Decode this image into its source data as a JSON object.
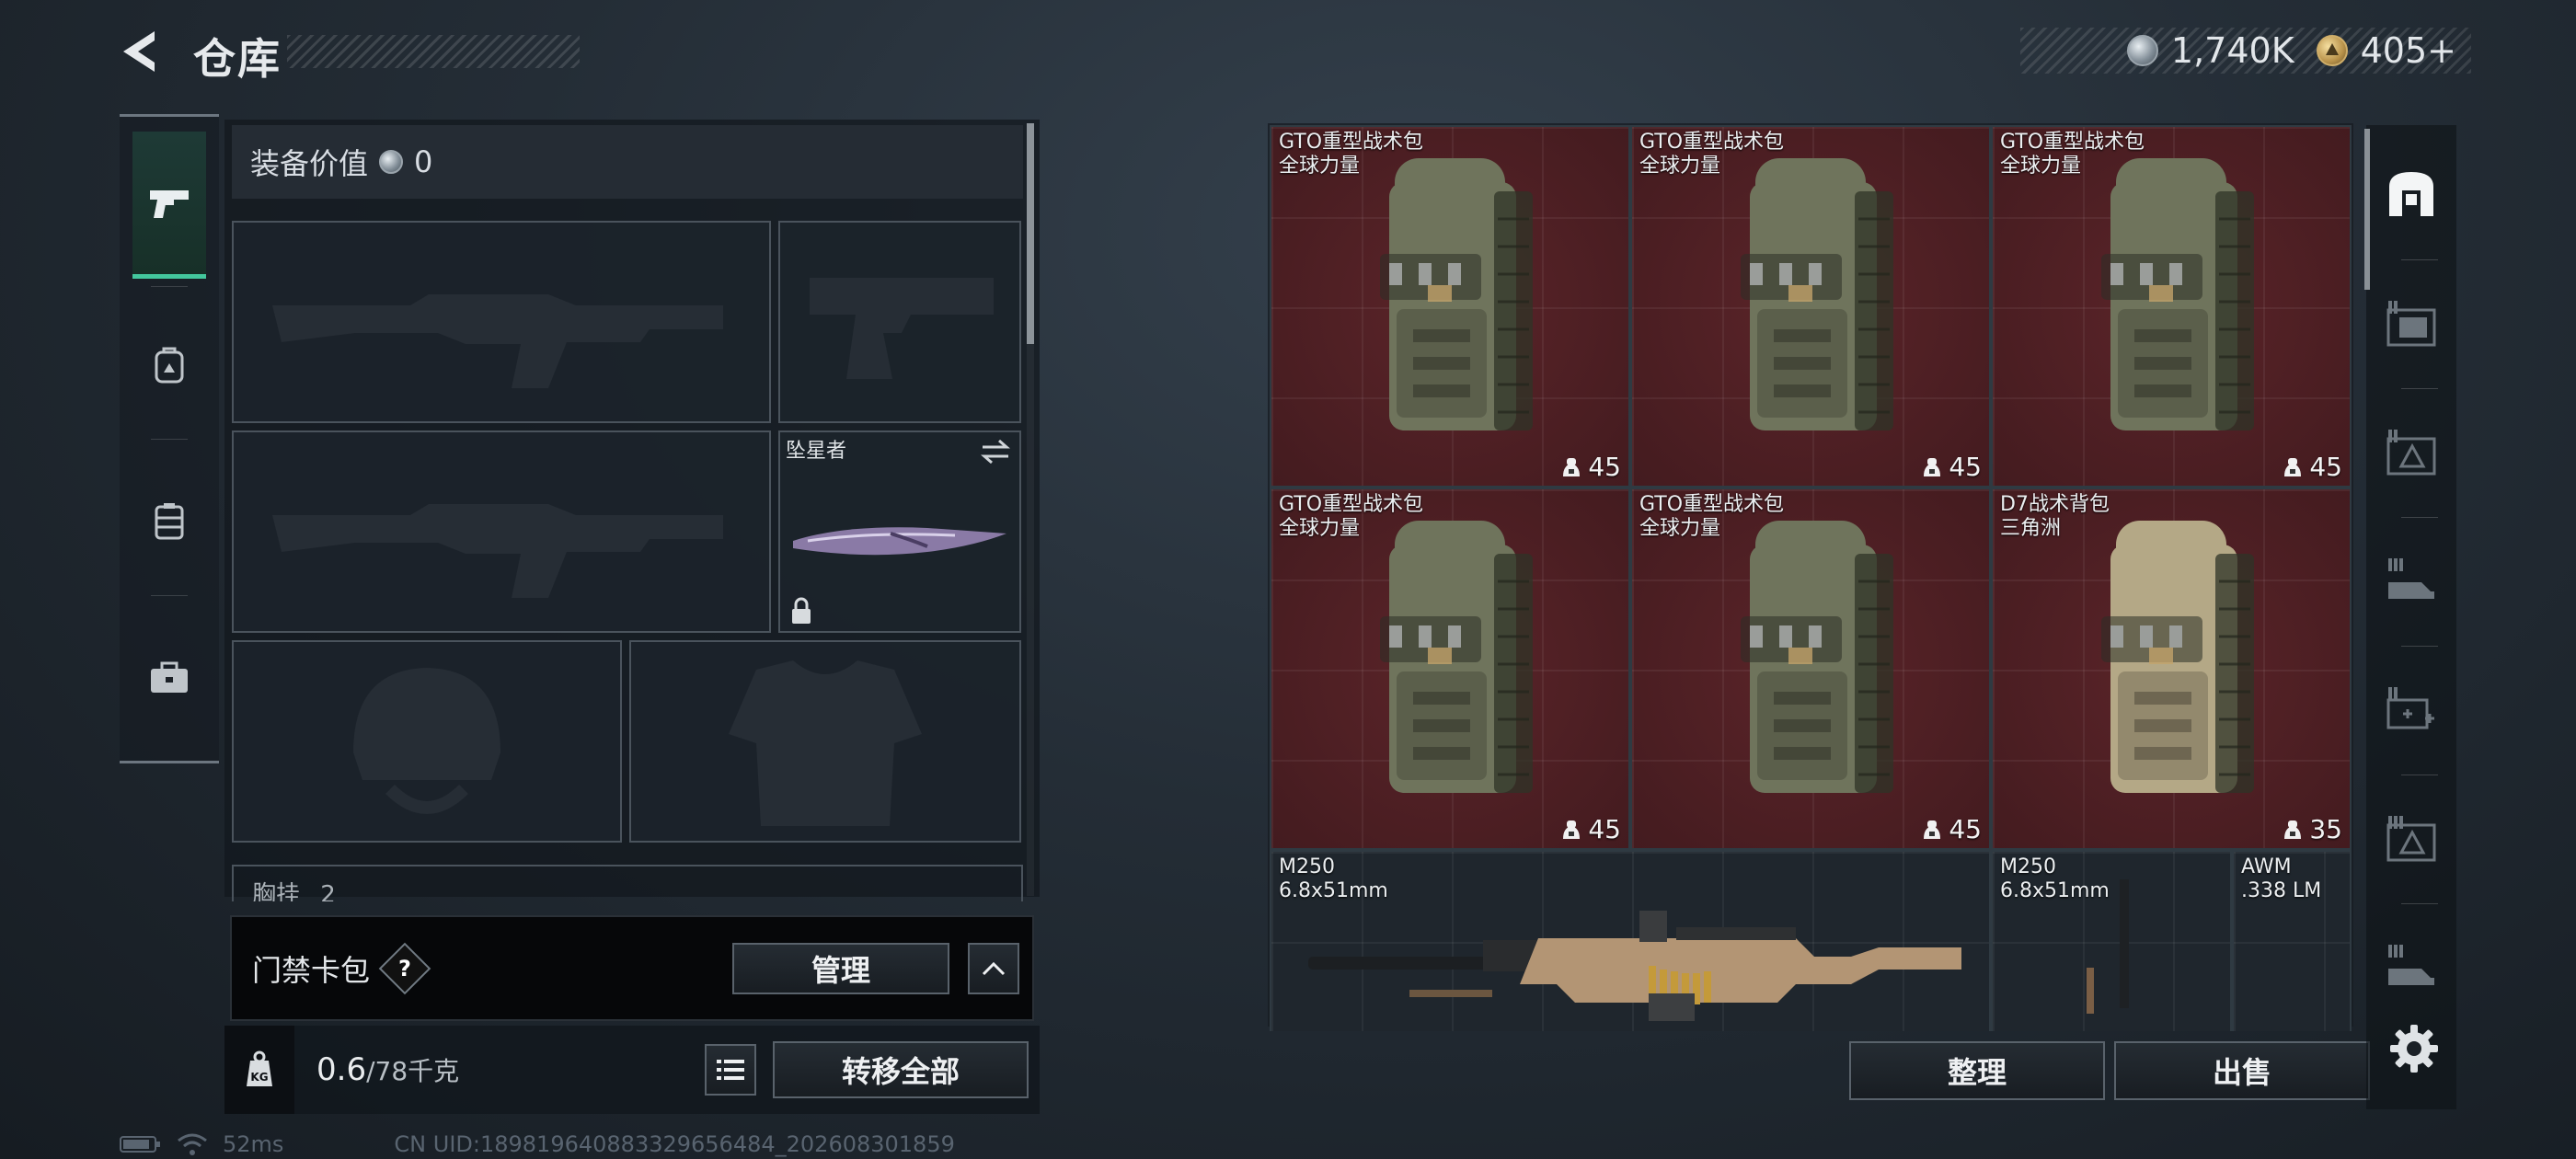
{
  "header": {
    "title": "仓库",
    "currencies": [
      {
        "icon": "silver-coin-icon",
        "value": "1,740K"
      },
      {
        "icon": "gold-triangle-coin-icon",
        "value": "405+"
      }
    ]
  },
  "left_tabs": [
    {
      "icon": "pistol-icon",
      "active": true
    },
    {
      "icon": "backpack-icon",
      "active": false
    },
    {
      "icon": "chest-rig-icon",
      "active": false
    },
    {
      "icon": "briefcase-icon",
      "active": false
    }
  ],
  "loadout": {
    "equip_value_label": "装备价值",
    "equip_value": "0",
    "melee_slot_label": "坠星者",
    "chest_label": "胸挂",
    "chest_count": "2"
  },
  "keycard": {
    "label": "门禁卡包",
    "help": "?",
    "manage_label": "管理"
  },
  "weight": {
    "kg_icon_label": "KG",
    "current": "0.6",
    "max": "/78千克",
    "transfer_all_label": "转移全部"
  },
  "status": {
    "ping": "52ms",
    "uid": "CN UID:18981964088332965​6484_202608301859"
  },
  "storage_items": [
    {
      "name": "GTO重型战术包",
      "sub": "全球力量",
      "capacity": "45"
    },
    {
      "name": "GTO重型战术包",
      "sub": "全球力量",
      "capacity": "45"
    },
    {
      "name": "GTO重型战术包",
      "sub": "全球力量",
      "capacity": "45"
    },
    {
      "name": "GTO重型战术包",
      "sub": "全球力量",
      "capacity": "45"
    },
    {
      "name": "GTO重型战术包",
      "sub": "全球力量",
      "capacity": "45"
    },
    {
      "name": "D7战术背包",
      "sub": "三角洲",
      "capacity": "35"
    }
  ],
  "weapon_items": [
    {
      "name": "M250",
      "sub": "6.8x51mm"
    },
    {
      "name": "M250",
      "sub": "6.8x51mm"
    },
    {
      "name": "AWM",
      "sub": ".338 LM"
    }
  ],
  "actions": {
    "organize_label": "整理",
    "sell_label": "出售"
  },
  "right_categories": [
    {
      "icon": "all-items-icon",
      "active": true
    },
    {
      "icon": "storage-1-icon"
    },
    {
      "icon": "storage-2-icon"
    },
    {
      "icon": "storage-3-icon"
    },
    {
      "icon": "storage-medical-icon"
    },
    {
      "icon": "storage-4-icon"
    },
    {
      "icon": "storage-5-icon"
    }
  ],
  "colors": {
    "accent_green": "#43c79d",
    "item_red_bg": "#4a1e22",
    "panel_bg": "#12171d"
  }
}
